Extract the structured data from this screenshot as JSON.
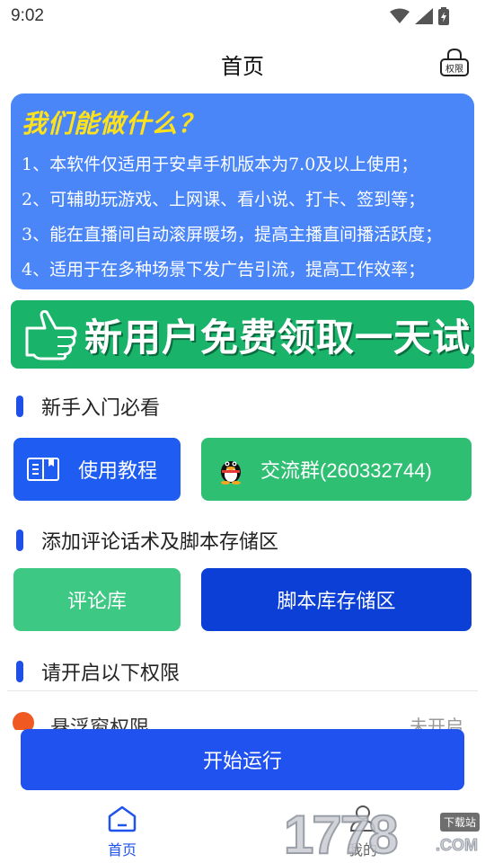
{
  "status_bar": {
    "time": "9:02",
    "icons": [
      "wifi-icon",
      "signal-icon",
      "battery-icon"
    ]
  },
  "app_bar": {
    "title": "首页",
    "permission_label": "权限"
  },
  "intro": {
    "heading": "我们能做什么？",
    "lines": [
      "1、本软件仅适用于安卓手机版本为7.0及以上使用；",
      "2、可辅助玩游戏、上网课、看小说、打卡、签到等；",
      "3、能在直播间自动滚屏暖场，提高主播直间播活跃度；",
      "4、适用于在多种场景下发广告引流，提高工作效率；"
    ]
  },
  "banner": {
    "text": "新用户免费领取一天试用"
  },
  "sections": {
    "beginner": "新手入门必看",
    "storage": "添加评论话术及脚本存储区",
    "permissions": "请开启以下权限"
  },
  "buttons": {
    "tutorial": "使用教程",
    "group": "交流群(260332744)",
    "comments": "评论库",
    "scripts": "脚本库存储区",
    "run": "开始运行"
  },
  "permission_item": {
    "label": "悬浮窗权限",
    "status": "未开启"
  },
  "bottom_nav": {
    "home": "首页",
    "mine": "我的"
  },
  "watermark": {
    "digits": "1778",
    "badge": "下载站",
    "suffix": ".COM"
  },
  "colors": {
    "primary_blue": "#1f52ee",
    "intro_blue": "#4a86f7",
    "banner_green": "#19b36a",
    "group_green": "#2ebf72",
    "comments_green": "#3dc883",
    "scripts_blue": "#0b3fd6",
    "heading_yellow": "#ffe21a"
  }
}
